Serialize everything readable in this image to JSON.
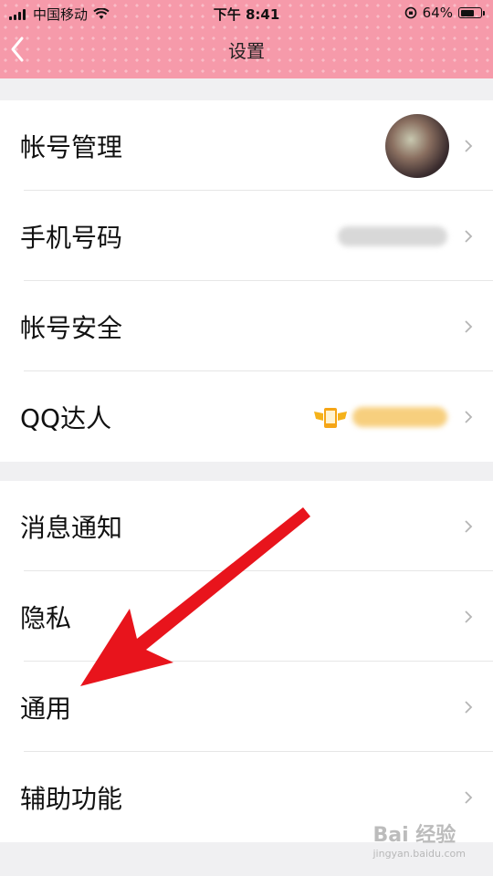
{
  "status_bar": {
    "carrier": "中国移动",
    "time": "下午 8:41",
    "battery_percent": "64%",
    "battery_level": 0.64
  },
  "nav": {
    "title": "设置"
  },
  "group1": {
    "rows": [
      {
        "label": "帐号管理"
      },
      {
        "label": "手机号码"
      },
      {
        "label": "帐号安全"
      },
      {
        "label": "QQ达人"
      }
    ]
  },
  "group2": {
    "rows": [
      {
        "label": "消息通知"
      },
      {
        "label": "隐私"
      },
      {
        "label": "通用"
      },
      {
        "label": "辅助功能"
      }
    ]
  },
  "watermark": {
    "text": "Bai 经验",
    "sub": "jingyan.baidu.com"
  },
  "colors": {
    "header": "#f69aaa",
    "arrow": "#e8141c",
    "background": "#f0f0f2"
  }
}
